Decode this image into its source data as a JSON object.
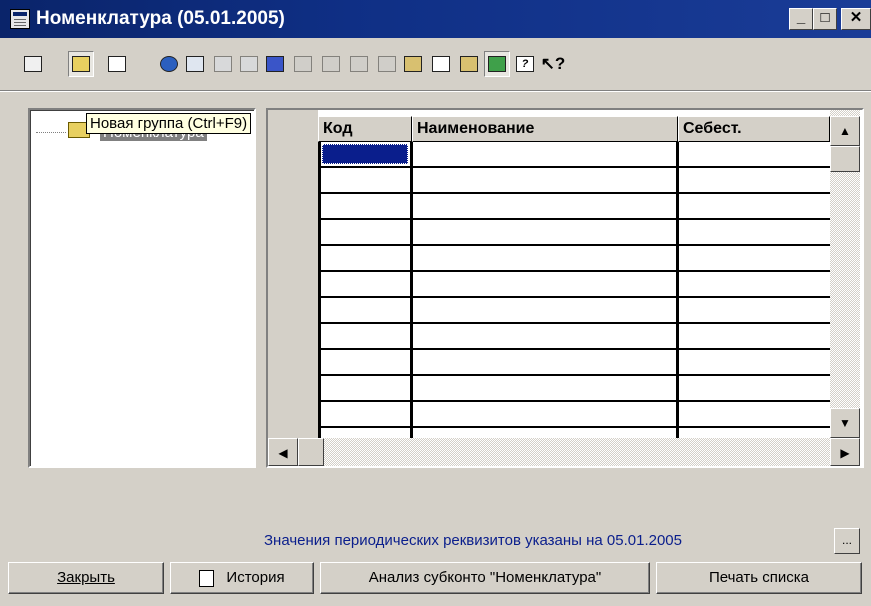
{
  "window": {
    "title": "Номенклатура  (05.01.2005)"
  },
  "titlebar_buttons": [
    {
      "name": "minimize-button",
      "glyph": "_"
    },
    {
      "name": "maximize-button",
      "glyph": "□"
    },
    {
      "name": "close-button",
      "glyph": "✕"
    }
  ],
  "toolbar": {
    "tools": [
      {
        "name": "new-item-tool-icon"
      },
      {
        "name": "new-group-tool-icon"
      },
      {
        "name": "edit-tool-icon"
      },
      {
        "name": "find-tool-icon"
      },
      {
        "name": "copy-item-tool-icon"
      },
      {
        "name": "delete-tool-icon"
      },
      {
        "name": "mark-tool-icon"
      },
      {
        "name": "move-to-group-tool-icon"
      },
      {
        "name": "up-level-tool-icon"
      },
      {
        "name": "hierarchy-tool-icon"
      },
      {
        "name": "filter-tool-icon"
      },
      {
        "name": "clear-filter-tool-icon"
      },
      {
        "name": "paste-tool-icon"
      },
      {
        "name": "report-tool-icon"
      },
      {
        "name": "list-tool-icon"
      },
      {
        "name": "tree-view-tool-icon"
      },
      {
        "name": "help-tool-icon"
      },
      {
        "name": "context-help-tool-icon"
      }
    ]
  },
  "tooltip": {
    "text": "Новая группа (Ctrl+F9)"
  },
  "tree": {
    "root_label": "Номенклатура"
  },
  "table": {
    "columns": [
      "Код",
      "Наименование",
      "Себест."
    ]
  },
  "footer": {
    "info": "Значения периодических реквизитов указаны на 05.01.2005",
    "dots_label": "..."
  },
  "buttons": {
    "close": "Закрыть",
    "history": "История",
    "analysis": "Анализ субконто \"Номенклатура\"",
    "print": "Печать списка"
  }
}
